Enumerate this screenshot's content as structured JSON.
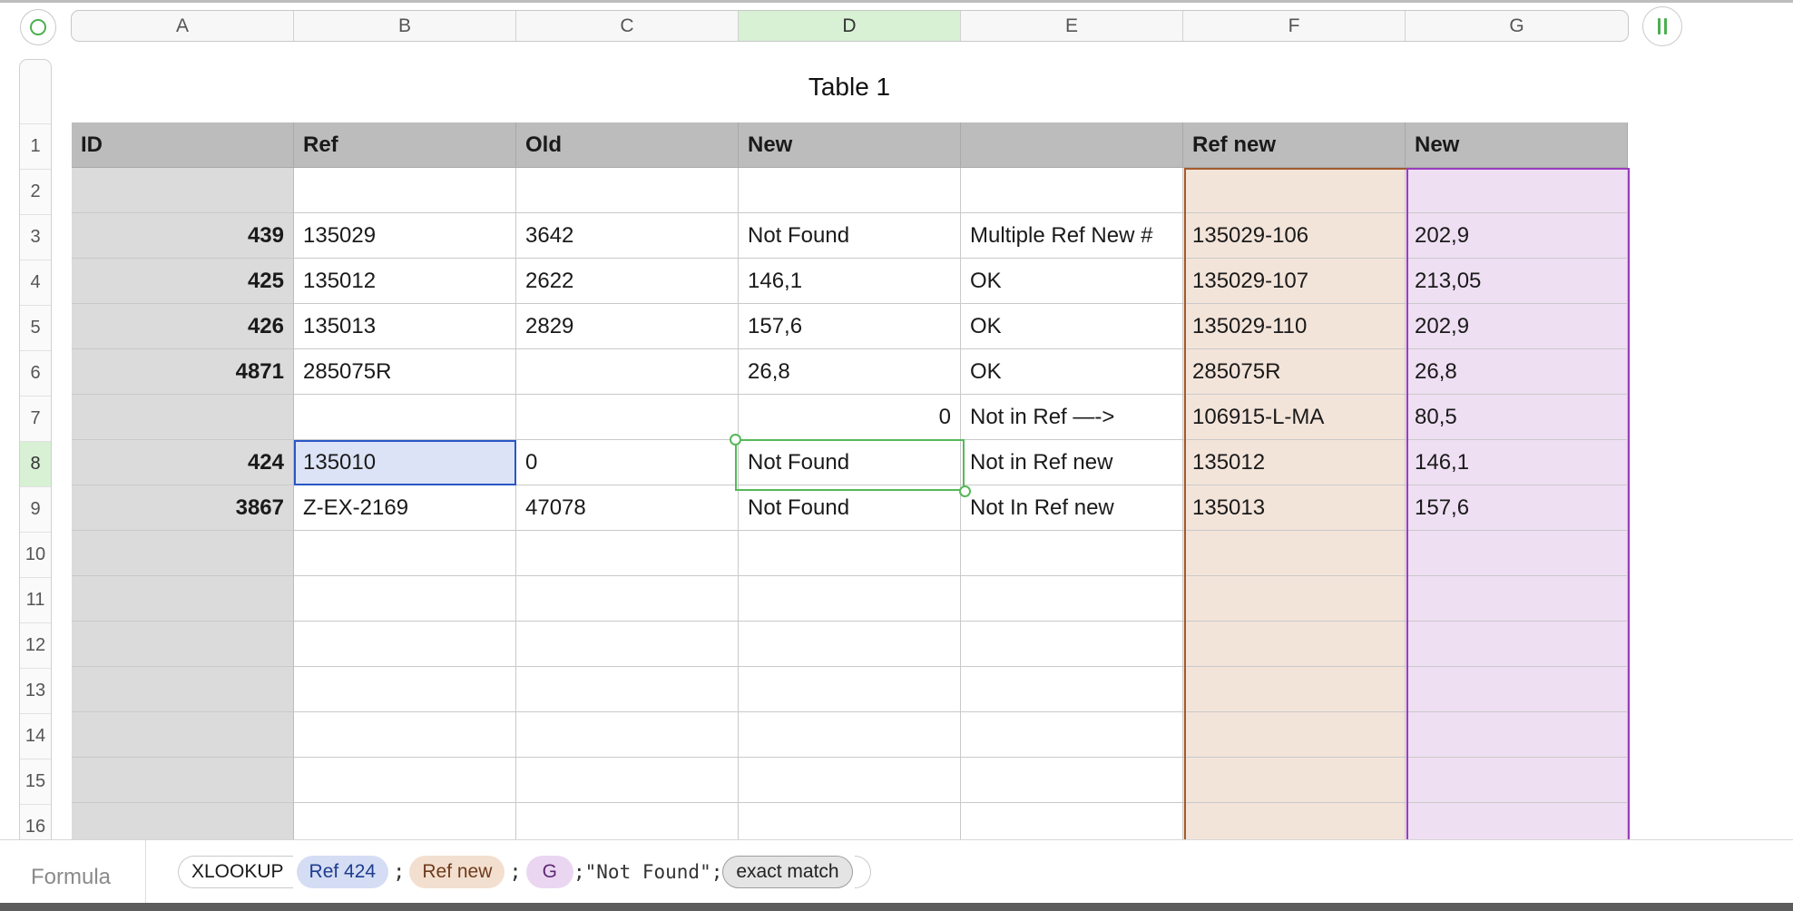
{
  "columns": [
    "A",
    "B",
    "C",
    "D",
    "E",
    "F",
    "G"
  ],
  "rows": [
    "1",
    "2",
    "3",
    "4",
    "5",
    "6",
    "7",
    "8",
    "9",
    "10",
    "11",
    "12",
    "13",
    "14",
    "15",
    "16"
  ],
  "table_title": "Table 1",
  "header_row": [
    "ID",
    "Ref",
    "Old",
    "New",
    "",
    "Ref new",
    "New"
  ],
  "data_rows": [
    [
      "",
      "",
      "",
      "",
      "",
      "",
      ""
    ],
    [
      "439",
      "135029",
      "3642",
      "Not Found",
      "Multiple Ref New #",
      "135029-106",
      "202,9"
    ],
    [
      "425",
      "135012",
      "2622",
      "146,1",
      "OK",
      "135029-107",
      "213,05"
    ],
    [
      "426",
      "135013",
      "2829",
      "157,6",
      "OK",
      "135029-110",
      "202,9"
    ],
    [
      "4871",
      "285075R",
      "",
      "26,8",
      "OK",
      "285075R",
      "26,8"
    ],
    [
      "",
      "",
      "",
      "0",
      "Not in Ref —->",
      "106915-L-MA",
      "80,5"
    ],
    [
      "424",
      "135010",
      "0",
      "Not Found",
      "Not in Ref new",
      "135012",
      "146,1"
    ],
    [
      "3867",
      "Z-EX-2169",
      "47078",
      "Not Found",
      "Not In Ref new",
      "135013",
      "157,6"
    ],
    [
      "",
      "",
      "",
      "",
      "",
      "",
      ""
    ],
    [
      "",
      "",
      "",
      "",
      "",
      "",
      ""
    ],
    [
      "",
      "",
      "",
      "",
      "",
      "",
      ""
    ],
    [
      "",
      "",
      "",
      "",
      "",
      "",
      ""
    ],
    [
      "",
      "",
      "",
      "",
      "",
      "",
      ""
    ],
    [
      "",
      "",
      "",
      "",
      "",
      "",
      ""
    ],
    [
      "",
      "",
      "",
      "",
      "",
      "",
      ""
    ]
  ],
  "selected_column": "D",
  "selected_row": "8",
  "formula": {
    "label": "Formula",
    "function": "XLOOKUP",
    "arg1": "Ref 424",
    "sep": ";",
    "arg2": "Ref new",
    "arg3": "G",
    "arg4": ";\"Not Found\";",
    "arg5": "exact match"
  },
  "colors": {
    "ref_new_fill": "#f3e4da",
    "ref_new_border": "#a35a2c",
    "new_fill": "#efdff3",
    "new_border": "#9a3dbd",
    "selection": "#56b85a",
    "ref_highlight": "#dde3f6"
  }
}
